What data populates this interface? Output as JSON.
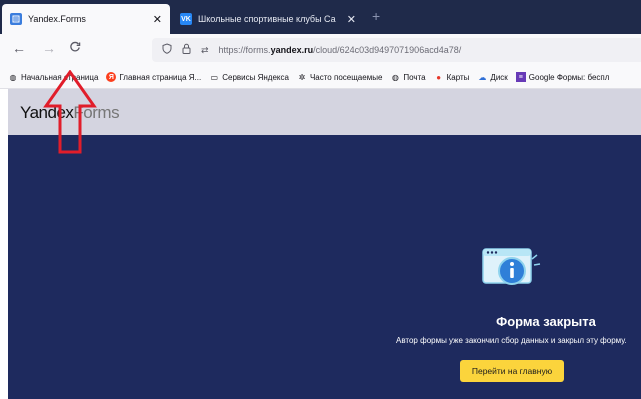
{
  "tabs": [
    {
      "title": "Yandex.Forms",
      "close": "✕",
      "active": true,
      "favicon": "yandex-forms-favicon"
    },
    {
      "title": "Школьные спортивные клубы Са",
      "close": "✕",
      "active": false,
      "favicon": "vk-favicon",
      "favicon_text": "VK"
    }
  ],
  "new_tab_label": "+",
  "nav": {
    "back": "←",
    "forward": "→",
    "reload": "C"
  },
  "address_bar": {
    "url_prefix": "https://forms.",
    "url_domain": "yandex.ru",
    "url_path": "/cloud/624c03d9497071906acd4a78/"
  },
  "bookmarks": [
    {
      "label": "Начальная страница",
      "icon": "globe-icon"
    },
    {
      "label": "Главная страница Я...",
      "icon": "yandex-icon"
    },
    {
      "label": "Сервисы Яндекса",
      "icon": "folder-icon"
    },
    {
      "label": "Часто посещаемые",
      "icon": "gear-icon"
    },
    {
      "label": "Почта",
      "icon": "globe-icon"
    },
    {
      "label": "Карты",
      "icon": "map-pin-icon"
    },
    {
      "label": "Диск",
      "icon": "cloud-icon"
    },
    {
      "label": "Google Формы: беспл",
      "icon": "google-forms-icon"
    }
  ],
  "page": {
    "logo_strong": "Yandex",
    "logo_light": "Forms",
    "closed_title": "Форма закрыта",
    "closed_text": "Автор формы уже закончил сбор данных и закрыл эту форму.",
    "home_button": "Перейти на главную"
  },
  "colors": {
    "page_bg": "#1e2a5e",
    "header_bg": "#d4d4e0",
    "button_bg": "#fbd43c",
    "arrow": "#e11d2a"
  }
}
